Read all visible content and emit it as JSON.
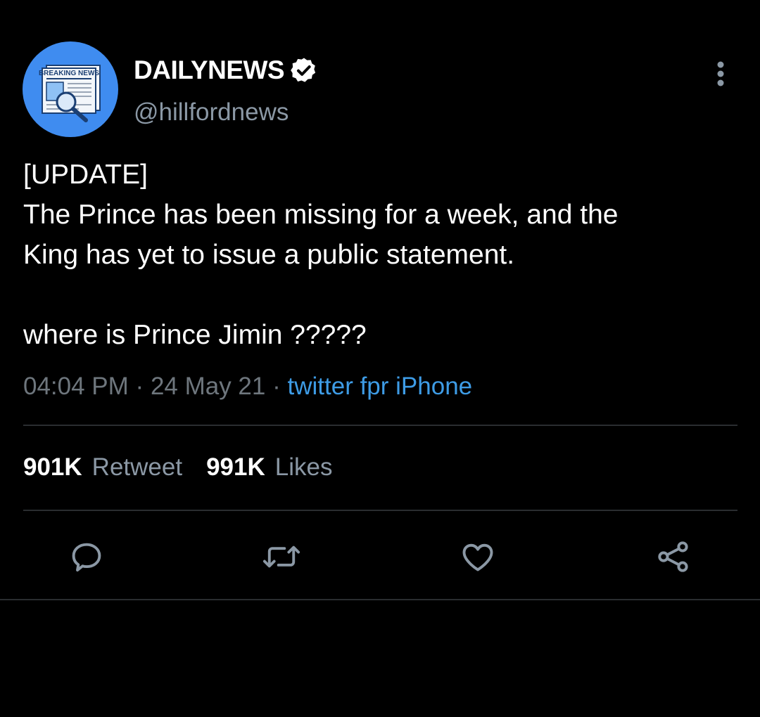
{
  "account": {
    "display_name": "DAILYNEWS",
    "handle": "@hillfordnews",
    "avatar_label": "BREAKING NEWS",
    "verified": true
  },
  "tweet": {
    "text": "[UPDATE]\nThe Prince has been missing for a week, and the\nKing has yet to issue a public statement.\n\nwhere is Prince Jimin ?????",
    "time": "04:04 PM",
    "separator": "·",
    "date": "24 May 21",
    "source": "twitter fpr iPhone"
  },
  "stats": {
    "retweets_count": "901K",
    "retweets_label": "Retweet",
    "likes_count": "991K",
    "likes_label": "Likes"
  },
  "actions": [
    {
      "name": "reply",
      "icon": "reply-icon"
    },
    {
      "name": "retweet",
      "icon": "retweet-icon"
    },
    {
      "name": "like",
      "icon": "heart-icon"
    },
    {
      "name": "share",
      "icon": "share-icon"
    }
  ],
  "colors": {
    "background": "#000000",
    "primary_text": "#ffffff",
    "secondary_text": "#8b98a5",
    "link": "#3e9ce6",
    "avatar_bg": "#3f8cf0",
    "divider": "#2a2d30"
  }
}
